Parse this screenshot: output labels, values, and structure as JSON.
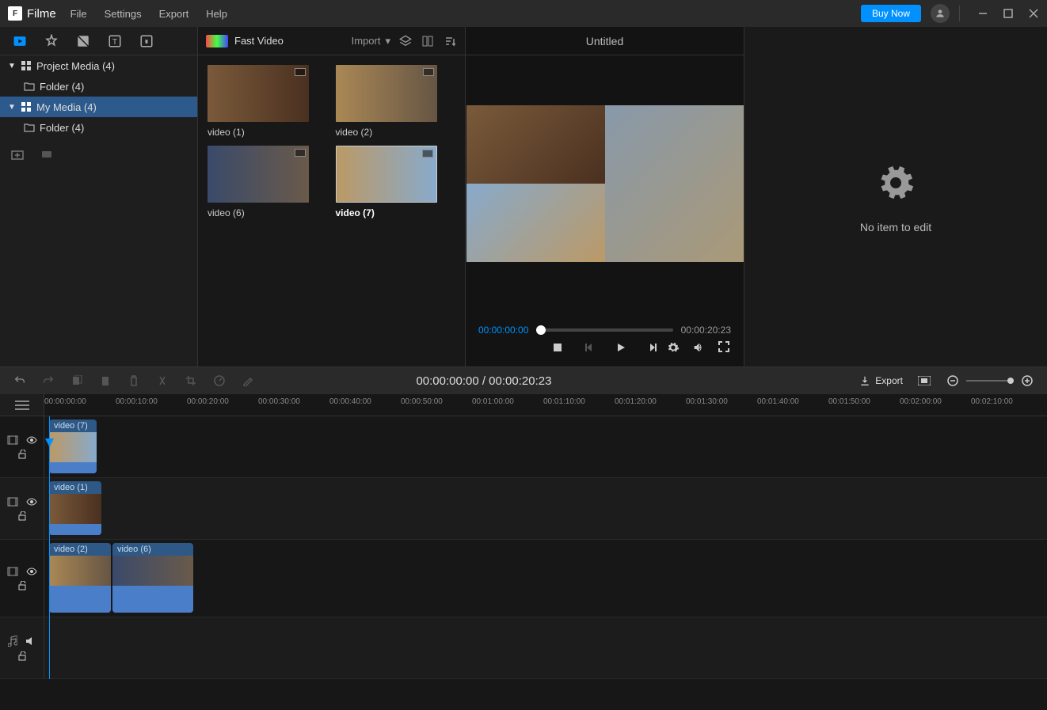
{
  "app": {
    "name": "Filme"
  },
  "menu": {
    "file": "File",
    "settings": "Settings",
    "export": "Export",
    "help": "Help"
  },
  "titlebar": {
    "buy": "Buy Now"
  },
  "tools": {
    "fast_video": "Fast Video",
    "import": "Import"
  },
  "tree": {
    "project_media": "Project Media (4)",
    "folder_1": "Folder (4)",
    "my_media": "My Media (4)",
    "folder_2": "Folder (4)"
  },
  "media": {
    "v1": "video (1)",
    "v2": "video (2)",
    "v6": "video (6)",
    "v7": "video (7)"
  },
  "preview": {
    "title": "Untitled",
    "time_cur": "00:00:00:00",
    "time_dur": "00:00:20:23"
  },
  "edit": {
    "no_item": "No item to edit"
  },
  "timeline": {
    "time_display": "00:00:00:00 / 00:00:20:23",
    "export": "Export",
    "ruler": [
      "00:00:00:00",
      "00:00:10:00",
      "00:00:20:00",
      "00:00:30:00",
      "00:00:40:00",
      "00:00:50:00",
      "00:01:00:00",
      "00:01:10:00",
      "00:01:20:00",
      "00:01:30:00",
      "00:01:40:00",
      "00:01:50:00",
      "00:02:00:00",
      "00:02:10:00"
    ],
    "clips": {
      "t1": "video (7)",
      "t2": "video (1)",
      "t3a": "video (2)",
      "t3b": "video (6)"
    }
  }
}
